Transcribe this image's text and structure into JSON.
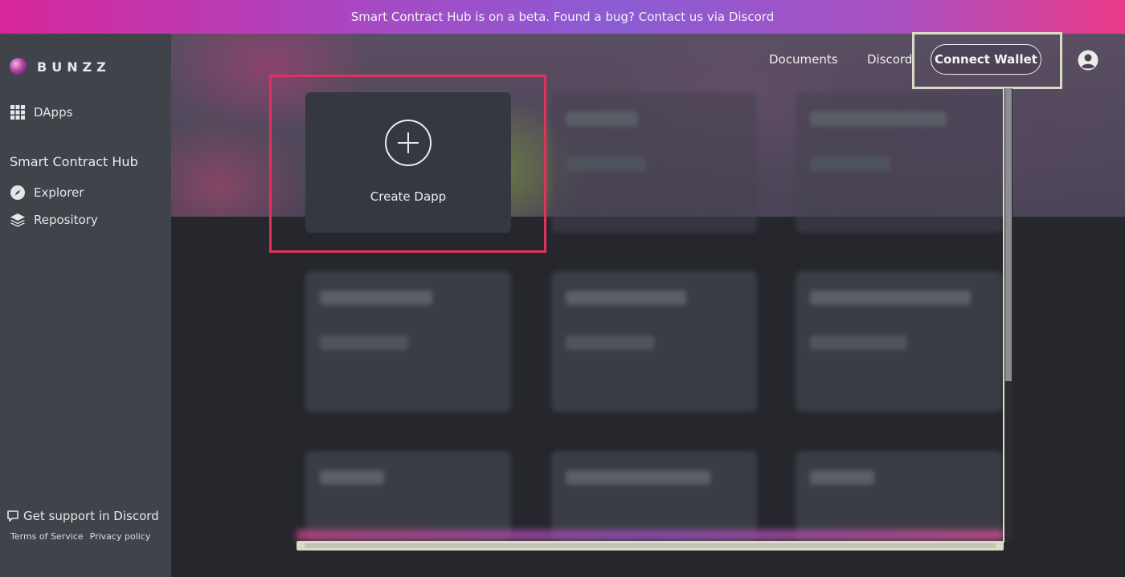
{
  "banner": {
    "text": "Smart Contract Hub is on a beta. Found a bug? Contact us via Discord"
  },
  "brand": {
    "name": "BUNZZ",
    "icon": "bunzz-logo-icon"
  },
  "sidebar": {
    "dapps_label": "DApps",
    "section_title": "Smart Contract Hub",
    "items": [
      {
        "label": "Explorer",
        "icon": "compass-icon"
      },
      {
        "label": "Repository",
        "icon": "layers-icon"
      }
    ],
    "support_label": "Get support in Discord",
    "terms_label": "Terms of Service",
    "privacy_label": "Privacy policy"
  },
  "header": {
    "documents_label": "Documents",
    "discord_label": "Discord",
    "connect_wallet_label": "Connect Wallet",
    "avatar_icon": "user-circle-icon"
  },
  "main": {
    "create_card_label": "Create Dapp",
    "create_card_icon": "plus-circle-icon"
  },
  "colors": {
    "banner_start": "#d7269a",
    "banner_mid": "#8b5cd5",
    "sidebar_bg": "#40434a",
    "main_bg": "#25272d",
    "highlight_red": "#e0325a",
    "highlight_pale": "#d9dcc6"
  }
}
